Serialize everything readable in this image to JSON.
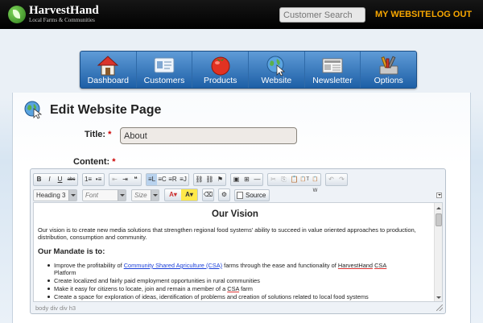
{
  "brand": {
    "name": "HarvestHand",
    "tagline": "Local Farms & Communities"
  },
  "search": {
    "placeholder": "Customer Search"
  },
  "toplinks": {
    "my_website": "MY WEBSITE",
    "logout": "LOG OUT"
  },
  "nav": {
    "items": [
      {
        "label": "Dashboard",
        "icon": "house-icon"
      },
      {
        "label": "Customers",
        "icon": "id-card-icon"
      },
      {
        "label": "Products",
        "icon": "tomato-icon"
      },
      {
        "label": "Website",
        "icon": "globe-cursor-icon"
      },
      {
        "label": "Newsletter",
        "icon": "newspaper-icon"
      },
      {
        "label": "Options",
        "icon": "tools-icon"
      }
    ]
  },
  "page": {
    "title": "Edit Website Page",
    "title_field_label": "Title:",
    "title_value": "About",
    "content_label": "Content:",
    "required_mark": "*"
  },
  "editor": {
    "toolbar1": [
      [
        "B",
        "I",
        "U",
        "abc"
      ],
      [
        "1≡",
        "•≡"
      ],
      [
        "⇤",
        "⇥",
        "❝"
      ],
      [
        "≡L",
        "≡C",
        "≡R",
        "≡J"
      ],
      [
        "⛓",
        "⛓x",
        "⚑"
      ],
      [
        "▣",
        "⊞",
        "—"
      ],
      [
        "✂",
        "⎘",
        "📋",
        "📋T",
        "📋W"
      ],
      [
        "↶",
        "↷"
      ]
    ],
    "format_combo": "Heading 3",
    "font_combo": "Font",
    "size_combo": "Size",
    "source_label": "Source",
    "statusbar": "body  div  div  h3",
    "content": {
      "heading": "Our Vision",
      "paragraph": "Our vision is to create new media solutions that strengthen regional food systems' ability to succeed in value oriented approaches to production, distribution, consumption and community.",
      "subheading": "Our Mandate is to:",
      "li1_prefix": "Improve the profitability of ",
      "li1_link": "Community Shared Agriculture (CSA)",
      "li1_mid": " farms through the ease and functionality of ",
      "li1_brand": "HarvestHand",
      "li1_sp": " ",
      "li1_csa": "CSA",
      "li1_line2": "Platform",
      "li2": "Create localized and fairly paid employment opportunities in rural communities",
      "li3_prefix": "Make it easy for citizens to locate, join and remain a member of a ",
      "li3_csa": "CSA",
      "li3_suffix": " farm",
      "li4": "Create a space for exploration of ideas, identification of problems and creation of solutions related to local food systems"
    }
  },
  "colors": {
    "accent_orange": "#f7a600",
    "nav_blue": "#2b6cb0",
    "required_red": "#cc0000",
    "link_blue": "#1a3fd9"
  }
}
